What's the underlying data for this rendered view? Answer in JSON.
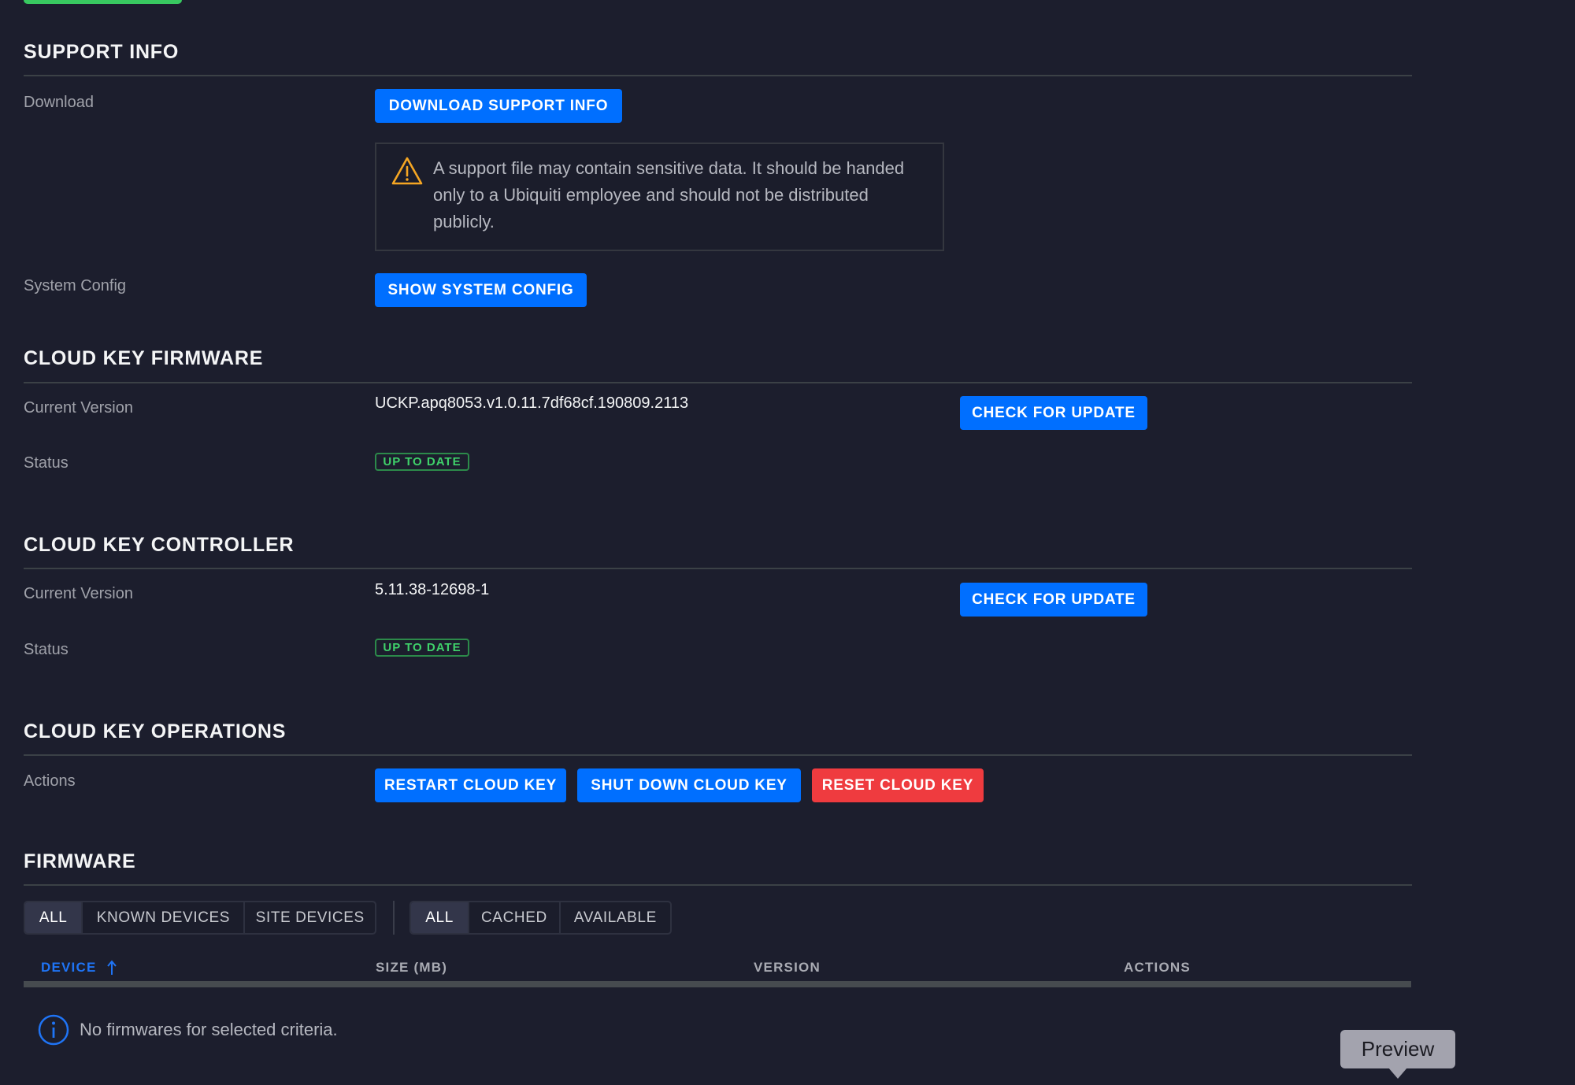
{
  "support_info": {
    "heading": "SUPPORT INFO",
    "download_label": "Download",
    "download_button": "DOWNLOAD SUPPORT INFO",
    "warning_text": "A support file may contain sensitive data. It should be handed only to a Ubiquiti employee and should not be distributed publicly.",
    "system_config_label": "System Config",
    "system_config_button": "SHOW SYSTEM CONFIG"
  },
  "firmware_section": {
    "heading": "CLOUD KEY FIRMWARE",
    "current_version_label": "Current Version",
    "current_version": "UCKP.apq8053.v1.0.11.7df68cf.190809.2113",
    "check_button": "CHECK FOR UPDATE",
    "status_label": "Status",
    "status": "UP TO DATE"
  },
  "controller_section": {
    "heading": "CLOUD KEY CONTROLLER",
    "current_version_label": "Current Version",
    "current_version": "5.11.38-12698-1",
    "check_button": "CHECK FOR UPDATE",
    "status_label": "Status",
    "status": "UP TO DATE"
  },
  "operations_section": {
    "heading": "CLOUD KEY OPERATIONS",
    "actions_label": "Actions",
    "restart_button": "RESTART CLOUD KEY",
    "shutdown_button": "SHUT DOWN CLOUD KEY",
    "reset_button": "RESET CLOUD KEY"
  },
  "firmware_list": {
    "heading": "FIRMWARE",
    "device_filters": [
      "ALL",
      "KNOWN DEVICES",
      "SITE DEVICES"
    ],
    "device_filter_selected": "ALL",
    "source_filters": [
      "ALL",
      "CACHED",
      "AVAILABLE"
    ],
    "source_filter_selected": "ALL",
    "columns": [
      "DEVICE",
      "SIZE (MB)",
      "VERSION",
      "ACTIONS"
    ],
    "sorted_column": "DEVICE",
    "sort_direction": "ascending",
    "rows": [],
    "empty_message": "No firmwares for selected criteria."
  },
  "tooltip": {
    "text": "Preview"
  },
  "colors": {
    "background": "#1c1e2d",
    "primary": "#006fff",
    "danger": "#ef3b3f",
    "success": "#3fd16a",
    "warning": "#f5a623"
  }
}
